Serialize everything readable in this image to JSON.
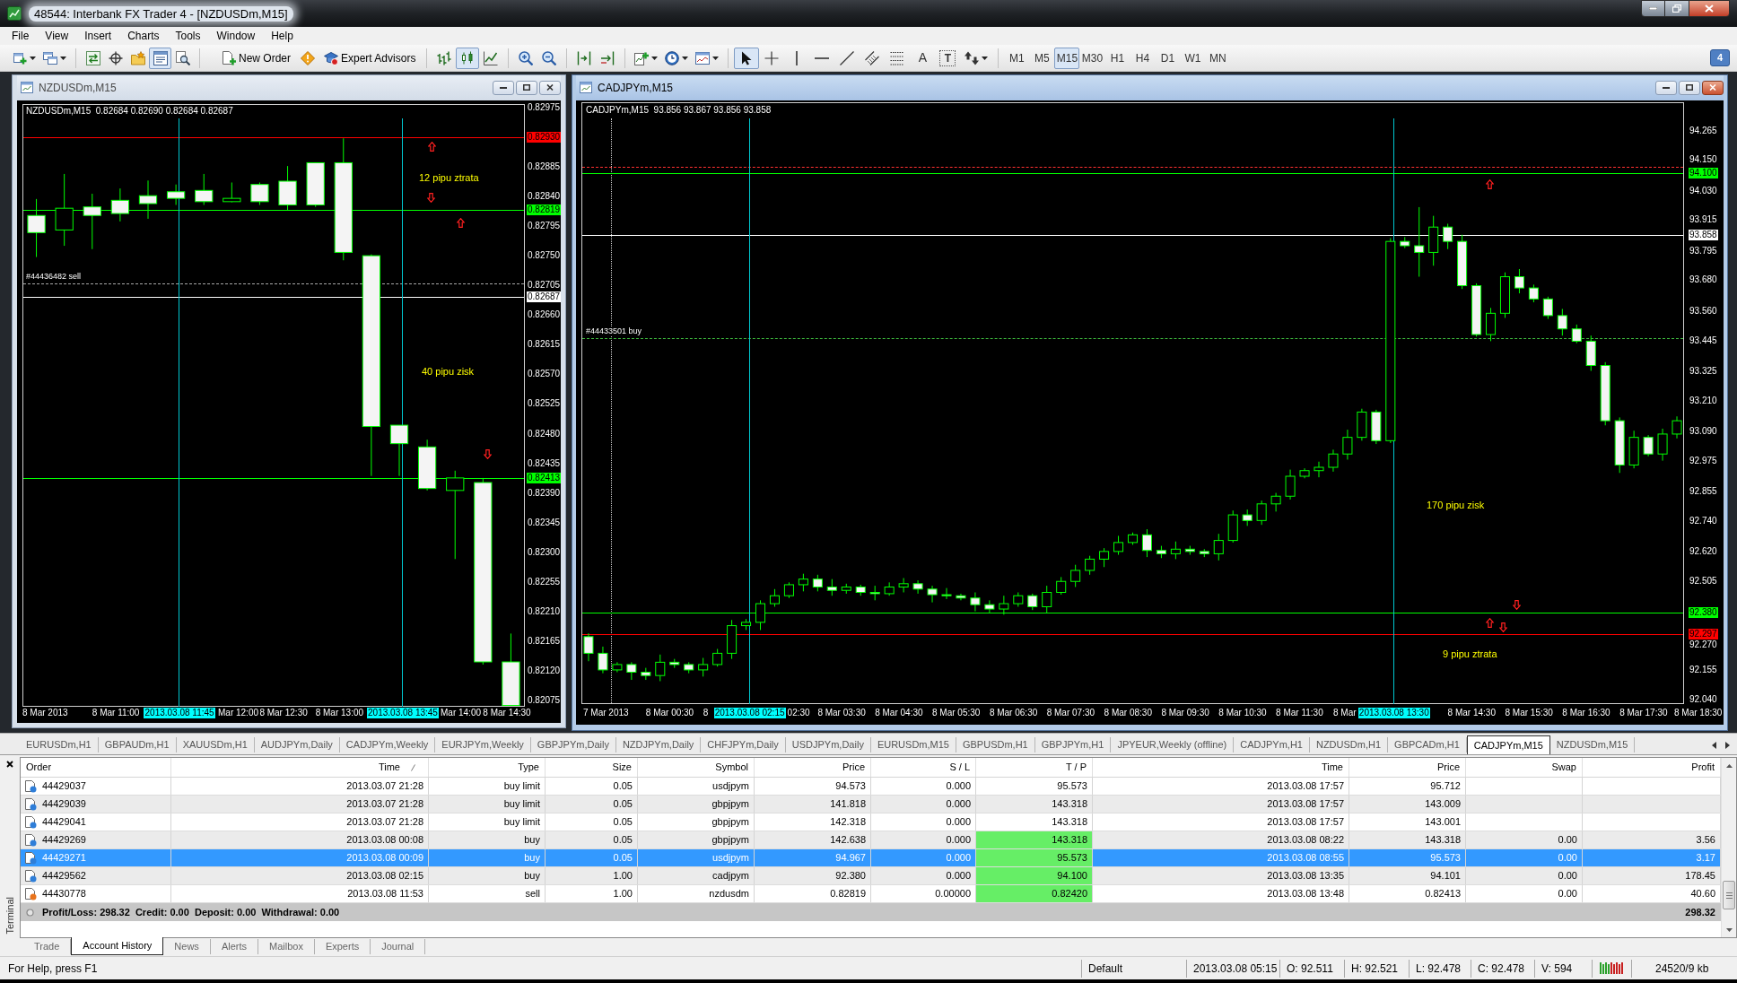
{
  "window": {
    "title": "48544: Interbank FX Trader 4 - [NZDUSDm,M15]"
  },
  "menu": [
    "File",
    "View",
    "Insert",
    "Charts",
    "Tools",
    "Window",
    "Help"
  ],
  "toolbar": {
    "view_buttons": [
      {
        "kind": "market_watch",
        "selected": false
      },
      {
        "kind": "data_window",
        "selected": false
      },
      {
        "kind": "navigator",
        "selected": false
      },
      {
        "kind": "terminal",
        "selected": true
      },
      {
        "kind": "tester",
        "selected": false
      }
    ],
    "new_order": "New Order",
    "expert_advisors": "Expert Advisors",
    "chart_types": [
      {
        "kind": "bars",
        "selected": false
      },
      {
        "kind": "candles",
        "selected": true
      },
      {
        "kind": "line",
        "selected": false
      }
    ],
    "drawing_tools": [
      {
        "kind": "cursor",
        "selected": true
      },
      {
        "kind": "crosshair",
        "selected": false
      },
      {
        "kind": "vertical_line",
        "selected": false
      },
      {
        "kind": "horizontal_line",
        "selected": false
      },
      {
        "kind": "trend_line",
        "selected": false
      },
      {
        "kind": "channel",
        "selected": false
      },
      {
        "kind": "fibonacci",
        "selected": false
      },
      {
        "kind": "text",
        "glyph": "A",
        "selected": false
      },
      {
        "kind": "label",
        "glyph": "T",
        "selected": false
      },
      {
        "kind": "arrows",
        "selected": false
      }
    ],
    "periods": [
      {
        "label": "M1",
        "selected": false
      },
      {
        "label": "M5",
        "selected": false
      },
      {
        "label": "M15",
        "selected": true
      },
      {
        "label": "M30",
        "selected": false
      },
      {
        "label": "H1",
        "selected": false
      },
      {
        "label": "H4",
        "selected": false
      },
      {
        "label": "D1",
        "selected": false
      },
      {
        "label": "W1",
        "selected": false
      },
      {
        "label": "MN",
        "selected": false
      }
    ],
    "messages": "4"
  },
  "charts": [
    {
      "title": "NZDUSDm,M15",
      "active": false,
      "header": "NZDUSDm,M15  0.82684 0.82690 0.82684 0.82687",
      "chart_data": {
        "type": "candlestick",
        "categories": [
          null,
          null,
          null,
          null,
          null,
          null,
          null,
          null,
          null,
          null,
          null,
          null,
          null,
          null,
          null,
          null,
          null,
          null
        ],
        "ohlc": [
          [
            0.82811,
            0.82836,
            0.82748,
            0.82785
          ],
          [
            0.82789,
            0.82874,
            0.82765,
            0.82822
          ],
          [
            0.82824,
            0.82844,
            0.8276,
            0.82811
          ],
          [
            0.82834,
            0.82852,
            0.82802,
            0.82814
          ],
          [
            0.82841,
            0.82864,
            0.82806,
            0.82829
          ],
          [
            0.82847,
            0.82858,
            0.82827,
            0.82837
          ],
          [
            0.82849,
            0.82874,
            0.82827,
            0.82832
          ],
          [
            0.82832,
            0.82861,
            0.82831,
            0.82837
          ],
          [
            0.82858,
            0.82861,
            0.82827,
            0.82832
          ],
          [
            0.82863,
            0.82886,
            0.82819,
            0.82827
          ],
          [
            0.82891,
            0.82891,
            0.82824,
            0.82827
          ],
          [
            0.82891,
            0.82928,
            0.82743,
            0.82755
          ],
          [
            0.8275,
            0.82752,
            0.82416,
            0.82491
          ],
          [
            0.82493,
            0.82493,
            0.82416,
            0.82465
          ],
          [
            0.8246,
            0.82471,
            0.82394,
            0.82397
          ],
          [
            0.82394,
            0.82424,
            0.8229,
            0.82413
          ],
          [
            0.82406,
            0.82413,
            0.8213,
            0.82134
          ],
          [
            0.82134,
            0.82177,
            0.82068,
            0.82068
          ]
        ],
        "ylim": [
          0.82066,
          0.8298
        ],
        "yticks": [
          {
            "value": 0.82975,
            "label": "0.82975"
          },
          {
            "value": 0.82885,
            "label": "0.82885"
          },
          {
            "value": 0.8284,
            "label": "0.82840"
          },
          {
            "value": 0.82795,
            "label": "0.82795"
          },
          {
            "value": 0.8275,
            "label": "0.82750"
          },
          {
            "value": 0.82705,
            "label": "0.82705"
          },
          {
            "value": 0.8266,
            "label": "0.82660"
          },
          {
            "value": 0.82615,
            "label": "0.82615"
          },
          {
            "value": 0.8257,
            "label": "0.82570"
          },
          {
            "value": 0.82525,
            "label": "0.82525"
          },
          {
            "value": 0.8248,
            "label": "0.82480"
          },
          {
            "value": 0.82435,
            "label": "0.82435"
          },
          {
            "value": 0.8239,
            "label": "0.82390"
          },
          {
            "value": 0.82345,
            "label": "0.82345"
          },
          {
            "value": 0.823,
            "label": "0.82300"
          },
          {
            "value": 0.82255,
            "label": "0.82255"
          },
          {
            "value": 0.8221,
            "label": "0.82210"
          },
          {
            "value": 0.82165,
            "label": "0.82165"
          },
          {
            "value": 0.8212,
            "label": "0.82120"
          },
          {
            "value": 0.82075,
            "label": "0.82075"
          }
        ],
        "ref_lines": [
          {
            "axis": "y",
            "value": 0.8293,
            "label": "0.82930",
            "color": "#ff0000"
          },
          {
            "axis": "y",
            "value": 0.82819,
            "label": "0.82819",
            "color": "#00ff00"
          },
          {
            "axis": "y",
            "value": 0.82708,
            "color": "#a8a8a8"
          },
          {
            "axis": "y",
            "value": 0.82687,
            "label": "0.82687",
            "color": "#ffffff"
          },
          {
            "axis": "y",
            "value": 0.82413,
            "label": "0.82413",
            "color": "#00ff00"
          }
        ]
      },
      "time_labels": [
        {
          "text": "8 Mar 2013",
          "highlighted": false
        },
        {
          "text": "8 Mar 11:00",
          "highlighted": false
        },
        {
          "text": "2013.03.08 11:45",
          "highlighted": true
        },
        {
          "text": "Mar 12:00",
          "highlighted": false
        },
        {
          "text": "8 Mar 12:30",
          "highlighted": false
        },
        {
          "text": "8 Mar 13:00",
          "highlighted": false
        },
        {
          "text": "2013.03.08 13:45",
          "highlighted": true
        },
        {
          "text": "Mar 14:00",
          "highlighted": false
        },
        {
          "text": "8 Mar 14:30",
          "highlighted": false
        }
      ],
      "order_label": "#44436482 sell",
      "notes": [
        "12 pipu ztrata",
        "40 pipu zisk"
      ]
    },
    {
      "title": "CADJPYm,M15",
      "active": true,
      "header": "CADJPYm,M15  93.856 93.867 93.856 93.858",
      "chart_data": {
        "type": "candlestick",
        "categories": [
          null,
          null,
          null,
          null,
          null,
          null,
          null,
          null,
          null,
          null,
          null,
          null,
          null,
          null,
          null,
          null,
          null,
          null,
          null,
          null,
          null,
          null,
          null,
          null,
          null,
          null,
          null,
          null,
          null,
          null,
          null,
          null,
          null,
          null,
          null,
          null,
          null,
          null,
          null,
          null,
          null,
          null,
          null,
          null,
          null,
          null,
          null,
          null,
          null,
          null,
          null,
          null,
          null,
          null,
          null,
          null,
          null,
          null,
          null,
          null,
          null,
          null,
          null,
          null,
          null,
          null,
          null,
          null,
          null,
          null,
          null,
          null,
          null,
          null,
          null,
          null,
          null
        ],
        "ohlc": [
          [
            92.287,
            92.3,
            92.191,
            92.222
          ],
          [
            92.222,
            92.248,
            92.144,
            92.157
          ],
          [
            92.157,
            92.187,
            92.148,
            92.178
          ],
          [
            92.178,
            92.187,
            92.118,
            92.148
          ],
          [
            92.148,
            92.165,
            92.118,
            92.135
          ],
          [
            92.135,
            92.217,
            92.113,
            92.187
          ],
          [
            92.187,
            92.2,
            92.165,
            92.178
          ],
          [
            92.178,
            92.187,
            92.144,
            92.157
          ],
          [
            92.157,
            92.204,
            92.131,
            92.178
          ],
          [
            92.178,
            92.239,
            92.17,
            92.222
          ],
          [
            92.222,
            92.352,
            92.2,
            92.33
          ],
          [
            92.33,
            92.356,
            92.313,
            92.343
          ],
          [
            92.343,
            92.429,
            92.313,
            92.416
          ],
          [
            92.416,
            92.473,
            92.404,
            92.447
          ],
          [
            92.447,
            92.499,
            92.438,
            92.49
          ],
          [
            92.49,
            92.533,
            92.464,
            92.512
          ],
          [
            92.512,
            92.529,
            92.464,
            92.481
          ],
          [
            92.481,
            92.512,
            92.447,
            92.468
          ],
          [
            92.468,
            92.494,
            92.455,
            92.481
          ],
          [
            92.481,
            92.49,
            92.447,
            92.46
          ],
          [
            92.46,
            92.486,
            92.429,
            92.455
          ],
          [
            92.455,
            92.499,
            92.447,
            92.481
          ],
          [
            92.481,
            92.516,
            92.46,
            92.494
          ],
          [
            92.494,
            92.507,
            92.455,
            92.473
          ],
          [
            92.473,
            92.486,
            92.421,
            92.451
          ],
          [
            92.451,
            92.477,
            92.434,
            92.447
          ],
          [
            92.447,
            92.455,
            92.429,
            92.438
          ],
          [
            92.438,
            92.46,
            92.386,
            92.412
          ],
          [
            92.412,
            92.429,
            92.378,
            92.395
          ],
          [
            92.395,
            92.447,
            92.373,
            92.416
          ],
          [
            92.416,
            92.46,
            92.404,
            92.447
          ],
          [
            92.447,
            92.455,
            92.391,
            92.404
          ],
          [
            92.404,
            92.486,
            92.378,
            92.46
          ],
          [
            92.46,
            92.52,
            92.451,
            92.503
          ],
          [
            92.503,
            92.568,
            92.481,
            92.546
          ],
          [
            92.546,
            92.603,
            92.529,
            92.59
          ],
          [
            92.59,
            92.633,
            92.559,
            92.62
          ],
          [
            92.62,
            92.681,
            92.607,
            92.655
          ],
          [
            92.655,
            92.694,
            92.646,
            92.685
          ],
          [
            92.685,
            92.707,
            92.598,
            92.624
          ],
          [
            92.624,
            92.642,
            92.594,
            92.611
          ],
          [
            92.611,
            92.659,
            92.59,
            92.629
          ],
          [
            92.629,
            92.642,
            92.607,
            92.62
          ],
          [
            92.62,
            92.629,
            92.598,
            92.611
          ],
          [
            92.611,
            92.689,
            92.585,
            92.663
          ],
          [
            92.663,
            92.78,
            92.655,
            92.763
          ],
          [
            92.763,
            92.784,
            92.72,
            92.741
          ],
          [
            92.741,
            92.819,
            92.724,
            92.806
          ],
          [
            92.806,
            92.849,
            92.776,
            92.836
          ],
          [
            92.836,
            92.94,
            92.823,
            92.914
          ],
          [
            92.914,
            92.945,
            92.906,
            92.936
          ],
          [
            92.936,
            92.971,
            92.91,
            92.949
          ],
          [
            92.949,
            93.018,
            92.932,
            93.001
          ],
          [
            93.001,
            93.096,
            92.979,
            93.066
          ],
          [
            93.066,
            93.178,
            93.053,
            93.165
          ],
          [
            93.165,
            93.174,
            93.04,
            93.053
          ],
          [
            93.053,
            93.845,
            93.044,
            93.832
          ],
          [
            93.832,
            93.849,
            93.806,
            93.815
          ],
          [
            93.815,
            93.966,
            93.694,
            93.789
          ],
          [
            93.789,
            93.932,
            93.737,
            93.888
          ],
          [
            93.888,
            93.901,
            93.802,
            93.832
          ],
          [
            93.832,
            93.858,
            93.646,
            93.659
          ],
          [
            93.659,
            93.668,
            93.46,
            93.468
          ],
          [
            93.468,
            93.572,
            93.442,
            93.551
          ],
          [
            93.551,
            93.711,
            93.533,
            93.694
          ],
          [
            93.694,
            93.724,
            93.629,
            93.65
          ],
          [
            93.65,
            93.663,
            93.594,
            93.607
          ],
          [
            93.607,
            93.616,
            93.529,
            93.542
          ],
          [
            93.542,
            93.568,
            93.464,
            93.49
          ],
          [
            93.49,
            93.507,
            93.434,
            93.442
          ],
          [
            93.442,
            93.464,
            93.326,
            93.347
          ],
          [
            93.347,
            93.36,
            93.113,
            93.131
          ],
          [
            93.131,
            93.144,
            92.927,
            92.958
          ],
          [
            92.958,
            93.092,
            92.945,
            93.066
          ],
          [
            93.066,
            93.075,
            92.992,
            93.001
          ],
          [
            93.001,
            93.1,
            92.975,
            93.079
          ],
          [
            93.079,
            93.148,
            93.062,
            93.131
          ]
        ],
        "ylim": [
          92.0235,
          94.376
        ],
        "yticks": [
          {
            "value": 94.265,
            "label": "94.265"
          },
          {
            "value": 94.15,
            "label": "94.150"
          },
          {
            "value": 94.03,
            "label": "94.030"
          },
          {
            "value": 93.915,
            "label": "93.915"
          },
          {
            "value": 93.795,
            "label": "93.795"
          },
          {
            "value": 93.68,
            "label": "93.680"
          },
          {
            "value": 93.56,
            "label": "93.560"
          },
          {
            "value": 93.445,
            "label": "93.445"
          },
          {
            "value": 93.325,
            "label": "93.325"
          },
          {
            "value": 93.21,
            "label": "93.210"
          },
          {
            "value": 93.09,
            "label": "93.090"
          },
          {
            "value": 92.975,
            "label": "92.975"
          },
          {
            "value": 92.855,
            "label": "92.855"
          },
          {
            "value": 92.74,
            "label": "92.740"
          },
          {
            "value": 92.62,
            "label": "92.620"
          },
          {
            "value": 92.505,
            "label": "92.505"
          },
          {
            "value": 92.27,
            "label": "92.270"
          },
          {
            "value": 92.155,
            "label": "92.155"
          },
          {
            "value": 92.04,
            "label": "92.040"
          }
        ],
        "ref_lines": [
          {
            "axis": "y",
            "value": 94.122,
            "color": "#ff3030"
          },
          {
            "axis": "y",
            "value": 94.1,
            "label": "94.100",
            "color": "#00ff00"
          },
          {
            "axis": "y",
            "value": 93.858,
            "label": "93.858",
            "color": "#ffffff"
          },
          {
            "axis": "y",
            "value": 93.455,
            "color": "#3fbf3f"
          },
          {
            "axis": "y",
            "value": 92.38,
            "label": "92.380",
            "color": "#00ff00"
          },
          {
            "axis": "y",
            "value": 92.297,
            "label": "92.297",
            "color": "#ff0000"
          }
        ]
      },
      "time_labels": [
        {
          "text": "7 Mar 2013",
          "highlighted": false
        },
        {
          "text": "8 Mar 00:30",
          "highlighted": false
        },
        {
          "text": "8",
          "highlighted": false
        },
        {
          "text": "2013.03.08 02:15",
          "highlighted": true
        },
        {
          "text": "02:30",
          "highlighted": false
        },
        {
          "text": "8 Mar 03:30",
          "highlighted": false
        },
        {
          "text": "8 Mar 04:30",
          "highlighted": false
        },
        {
          "text": "8 Mar 05:30",
          "highlighted": false
        },
        {
          "text": "8 Mar 06:30",
          "highlighted": false
        },
        {
          "text": "8 Mar 07:30",
          "highlighted": false
        },
        {
          "text": "8 Mar 08:30",
          "highlighted": false
        },
        {
          "text": "8 Mar 09:30",
          "highlighted": false
        },
        {
          "text": "8 Mar 10:30",
          "highlighted": false
        },
        {
          "text": "8 Mar 11:30",
          "highlighted": false
        },
        {
          "text": "8 Mar",
          "highlighted": false
        },
        {
          "text": "2013.03.08 13:30",
          "highlighted": true
        },
        {
          "text": "8 Mar 14:30",
          "highlighted": false
        },
        {
          "text": "8 Mar 15:30",
          "highlighted": false
        },
        {
          "text": "8 Mar 16:30",
          "highlighted": false
        },
        {
          "text": "8 Mar 17:30",
          "highlighted": false
        },
        {
          "text": "8 Mar 18:30",
          "highlighted": false
        }
      ],
      "order_label": "#44433501 buy",
      "notes": [
        "170 pipu zisk",
        "9 pipu ztrata"
      ]
    }
  ],
  "chart_tabs": [
    {
      "label": "EURUSDm,H1",
      "selected": false
    },
    {
      "label": "GBPAUDm,H1",
      "selected": false
    },
    {
      "label": "XAUUSDm,H1",
      "selected": false
    },
    {
      "label": "AUDJPYm,Daily",
      "selected": false
    },
    {
      "label": "CADJPYm,Weekly",
      "selected": false
    },
    {
      "label": "EURJPYm,Weekly",
      "selected": false
    },
    {
      "label": "GBPJPYm,Daily",
      "selected": false
    },
    {
      "label": "NZDJPYm,Daily",
      "selected": false
    },
    {
      "label": "CHFJPYm,Daily",
      "selected": false
    },
    {
      "label": "USDJPYm,Daily",
      "selected": false
    },
    {
      "label": "EURUSDm,M15",
      "selected": false
    },
    {
      "label": "GBPUSDm,H1",
      "selected": false
    },
    {
      "label": "GBPJPYm,H1",
      "selected": false
    },
    {
      "label": "JPYEUR,Weekly (offline)",
      "selected": false
    },
    {
      "label": "CADJPYm,H1",
      "selected": false
    },
    {
      "label": "NZDUSDm,H1",
      "selected": false
    },
    {
      "label": "GBPCADm,H1",
      "selected": false
    },
    {
      "label": "CADJPYm,M15",
      "selected": true
    },
    {
      "label": "NZDUSDm,M15",
      "selected": false
    }
  ],
  "terminal": {
    "side_label": "Terminal",
    "columns": [
      "Order",
      "Time",
      "Type",
      "Size",
      "Symbol",
      "Price",
      "S / L",
      "T / P",
      "Time",
      "Price",
      "Swap",
      "Profit"
    ],
    "rows": [
      {
        "order": "44429037",
        "open_time": "2013.03.07 21:28",
        "type": "buy limit",
        "size": "0.05",
        "symbol": "usdjpym",
        "open_price": "94.573",
        "sl": "0.000",
        "tp": "95.573",
        "tp_hit": false,
        "close_time": "2013.03.08 17:57",
        "close_price": "95.712",
        "selected": false,
        "color": "#2f7ed8"
      },
      {
        "order": "44429039",
        "open_time": "2013.03.07 21:28",
        "type": "buy limit",
        "size": "0.05",
        "symbol": "gbpjpym",
        "open_price": "141.818",
        "sl": "0.000",
        "tp": "143.318",
        "tp_hit": false,
        "close_time": "2013.03.08 17:57",
        "close_price": "143.009",
        "selected": false,
        "color": "#2f7ed8"
      },
      {
        "order": "44429041",
        "open_time": "2013.03.07 21:28",
        "type": "buy limit",
        "size": "0.05",
        "symbol": "gbpjpym",
        "open_price": "142.318",
        "sl": "0.000",
        "tp": "143.318",
        "tp_hit": false,
        "close_time": "2013.03.08 17:57",
        "close_price": "143.001",
        "selected": false,
        "color": "#2f7ed8"
      },
      {
        "order": "44429269",
        "open_time": "2013.03.08 00:08",
        "type": "buy",
        "size": "0.05",
        "symbol": "gbpjpym",
        "open_price": "142.638",
        "sl": "0.000",
        "tp": "143.318",
        "tp_hit": true,
        "close_time": "2013.03.08 08:22",
        "close_price": "143.318",
        "swap": "0.00",
        "profit": "3.56",
        "selected": false,
        "color": "#2f7ed8"
      },
      {
        "order": "44429271",
        "open_time": "2013.03.08 00:09",
        "type": "buy",
        "size": "0.05",
        "symbol": "usdjpym",
        "open_price": "94.967",
        "sl": "0.000",
        "tp": "95.573",
        "tp_hit": true,
        "close_time": "2013.03.08 08:55",
        "close_price": "95.573",
        "swap": "0.00",
        "profit": "3.17",
        "selected": true,
        "color": "#2f7ed8"
      },
      {
        "order": "44429562",
        "open_time": "2013.03.08 02:15",
        "type": "buy",
        "size": "1.00",
        "symbol": "cadjpym",
        "open_price": "92.380",
        "sl": "0.000",
        "tp": "94.100",
        "tp_hit": true,
        "close_time": "2013.03.08 13:35",
        "close_price": "94.101",
        "swap": "0.00",
        "profit": "178.45",
        "selected": false,
        "color": "#2f7ed8"
      },
      {
        "order": "44430778",
        "open_time": "2013.03.08 11:53",
        "type": "sell",
        "size": "1.00",
        "symbol": "nzdusdm",
        "open_price": "0.82819",
        "sl": "0.00000",
        "tp": "0.82420",
        "tp_hit": true,
        "close_time": "2013.03.08 13:48",
        "close_price": "0.82413",
        "swap": "0.00",
        "profit": "40.60",
        "selected": false,
        "color": "#e8731c"
      }
    ],
    "summary": "Profit/Loss: 298.32  Credit: 0.00  Deposit: 0.00  Withdrawal: 0.00",
    "total": "298.32",
    "tabs": [
      {
        "label": "Trade",
        "selected": false
      },
      {
        "label": "Account History",
        "selected": true
      },
      {
        "label": "News",
        "selected": false
      },
      {
        "label": "Alerts",
        "selected": false
      },
      {
        "label": "Mailbox",
        "selected": false
      },
      {
        "label": "Experts",
        "selected": false
      },
      {
        "label": "Journal",
        "selected": false
      }
    ]
  },
  "status_bar": {
    "help": "For Help, press F1",
    "fields": [
      "Default",
      "2013.03.08 05:15",
      "O: 92.511",
      "H: 92.521",
      "L: 92.478",
      "C: 92.478",
      "V: 594"
    ],
    "traffic": "24520/9 kb"
  }
}
